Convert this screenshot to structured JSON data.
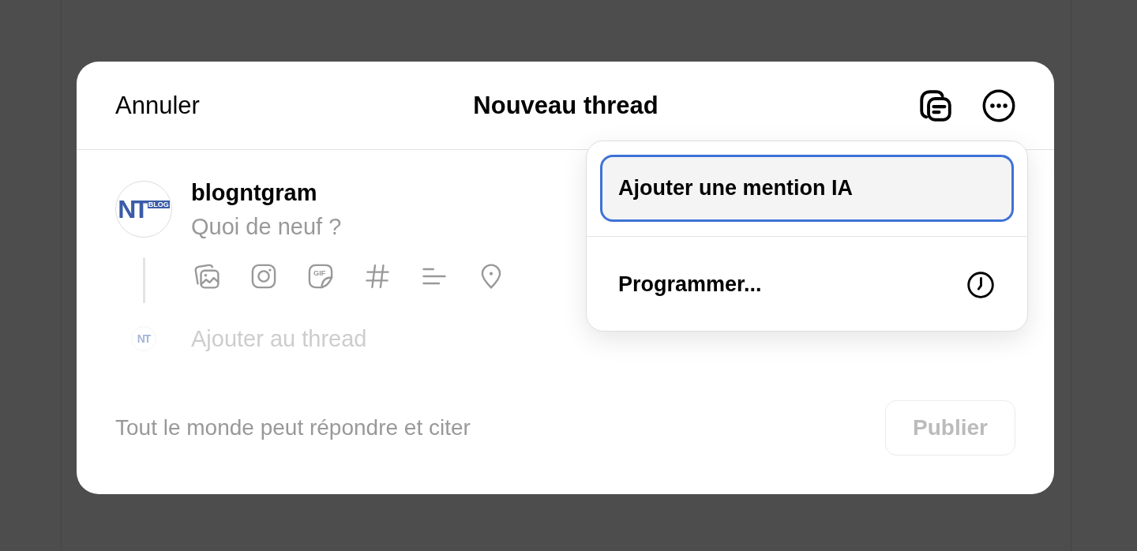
{
  "dialog": {
    "cancel_label": "Annuler",
    "title": "Nouveau thread"
  },
  "composer": {
    "avatar": {
      "logo_text": "NT",
      "logo_badge": "BLOG"
    },
    "username": "blogntgram",
    "placeholder": "Quoi de neuf ?",
    "toolbar": {
      "gif_label": "GIF"
    }
  },
  "add_to_thread": {
    "avatar": {
      "logo_text": "NT"
    },
    "placeholder": "Ajouter au thread",
    "disabled": true
  },
  "footer": {
    "reply_setting": "Tout le monde peut répondre et citer",
    "publish": {
      "label": "Publier",
      "disabled": true
    }
  },
  "menu": {
    "items": [
      {
        "label": "Ajouter une mention IA",
        "kind": "plain",
        "selected": true
      },
      {
        "label": "Programmer...",
        "kind": "clock",
        "selected": false
      }
    ]
  }
}
